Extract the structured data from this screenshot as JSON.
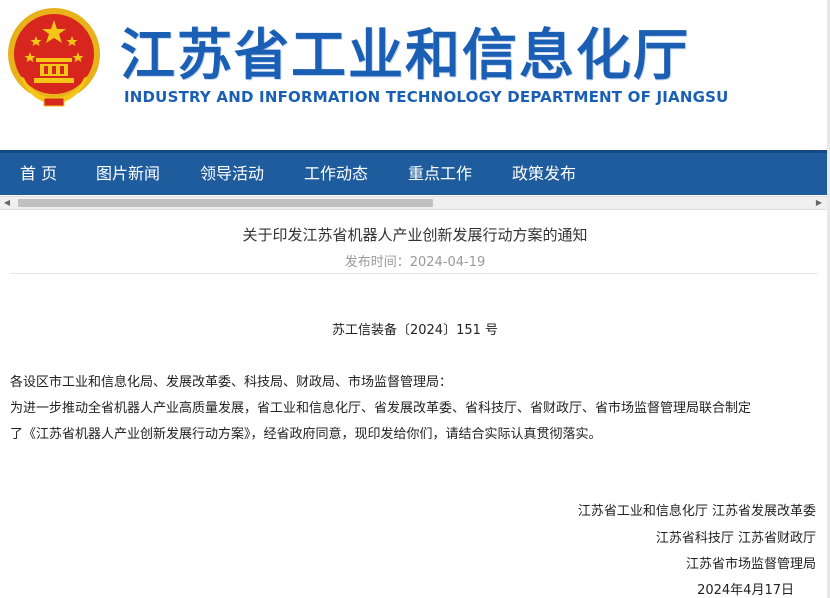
{
  "header": {
    "title": "江苏省工业和信息化厅",
    "subtitle": "INDUSTRY AND INFORMATION TECHNOLOGY DEPARTMENT OF JIANGSU",
    "emblem_icon": "national-emblem-icon"
  },
  "nav": {
    "items": [
      {
        "label": "首 页"
      },
      {
        "label": "图片新闻"
      },
      {
        "label": "领导活动"
      },
      {
        "label": "工作动态"
      },
      {
        "label": "重点工作"
      },
      {
        "label": "政策发布"
      }
    ]
  },
  "article": {
    "title": "关于印发江苏省机器人产业创新发展行动方案的通知",
    "publish_label": "发布时间：",
    "publish_date": "2024-04-19",
    "doc_number": "苏工信装备〔2024〕151 号",
    "salutation": "各设区市工业和信息化局、发展改革委、科技局、财政局、市场监督管理局：",
    "body_line1": "为进一步推动全省机器人产业高质量发展，省工业和信息化厅、省发展改革委、省科技厅、省财政厅、省市场监督管理局联合制定",
    "body_line2": "了《江苏省机器人产业创新发展行动方案》，经省政府同意，现印发给你们，请结合实际认真贯彻落实。",
    "signatures": [
      "江苏省工业和信息化厅  江苏省发展改革委",
      "江苏省科技厅  江苏省财政厅",
      "江苏省市场监督管理局",
      "2024年4月17日"
    ]
  },
  "colors": {
    "nav_bg": "#1e5c9e",
    "title_blue": "#1a5fb4",
    "emblem_red": "#d7261e",
    "emblem_gold": "#f5c518"
  }
}
